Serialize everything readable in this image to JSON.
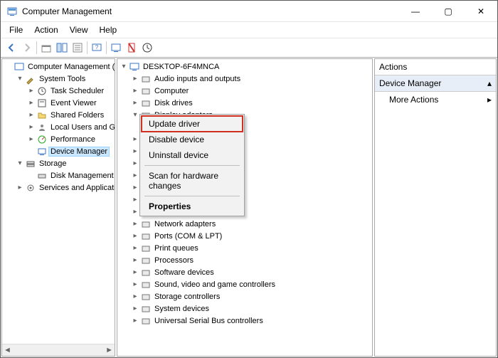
{
  "window": {
    "title": "Computer Management",
    "min_label": "—",
    "max_label": "▢",
    "close_label": "✕"
  },
  "menubar": [
    "File",
    "Action",
    "View",
    "Help"
  ],
  "left_tree": {
    "root": "Computer Management (Local)",
    "system_tools": {
      "label": "System Tools",
      "items": [
        "Task Scheduler",
        "Event Viewer",
        "Shared Folders",
        "Local Users and Groups",
        "Performance",
        "Device Manager"
      ]
    },
    "storage": {
      "label": "Storage",
      "items": [
        "Disk Management"
      ]
    },
    "services": {
      "label": "Services and Applications"
    }
  },
  "device_tree": {
    "root": "DESKTOP-6F4MNCA",
    "items": [
      {
        "label": "Audio inputs and outputs",
        "expand": "closed"
      },
      {
        "label": "Computer",
        "expand": "closed"
      },
      {
        "label": "Disk drives",
        "expand": "closed"
      },
      {
        "label": "Display adapters",
        "expand": "open"
      },
      {
        "label": "",
        "expand": "closed"
      },
      {
        "label": "",
        "expand": "closed"
      },
      {
        "label": "",
        "expand": "closed"
      },
      {
        "label": "",
        "expand": "closed"
      },
      {
        "label": "",
        "expand": "closed"
      },
      {
        "label": "",
        "expand": "closed"
      },
      {
        "label": "",
        "expand": "closed"
      },
      {
        "label": "Network adapters",
        "expand": "closed"
      },
      {
        "label": "Ports (COM & LPT)",
        "expand": "closed"
      },
      {
        "label": "Print queues",
        "expand": "closed"
      },
      {
        "label": "Processors",
        "expand": "closed"
      },
      {
        "label": "Software devices",
        "expand": "closed"
      },
      {
        "label": "Sound, video and game controllers",
        "expand": "closed"
      },
      {
        "label": "Storage controllers",
        "expand": "closed"
      },
      {
        "label": "System devices",
        "expand": "closed"
      },
      {
        "label": "Universal Serial Bus controllers",
        "expand": "closed"
      }
    ]
  },
  "context_menu": {
    "items": [
      {
        "label": "Update driver",
        "hl": true
      },
      {
        "label": "Disable device"
      },
      {
        "label": "Uninstall device"
      },
      {
        "sep": true
      },
      {
        "label": "Scan for hardware changes"
      },
      {
        "sep": true
      },
      {
        "label": "Properties",
        "bold": true
      }
    ]
  },
  "actions": {
    "header": "Actions",
    "sub": "Device Manager",
    "more": "More Actions"
  }
}
